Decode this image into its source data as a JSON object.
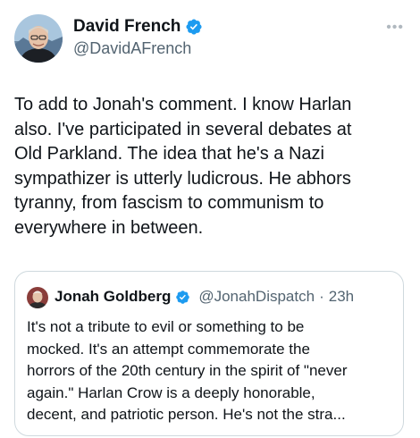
{
  "tweet": {
    "author_name": "David French",
    "author_handle": "@DavidAFrench",
    "more_label": "•••",
    "text_lines": [
      "To add to Jonah's comment. I know Harlan",
      "also. I've participated in several debates at",
      "Old Parkland. The idea that he's a Nazi",
      "sympathizer is utterly ludicrous. He abhors",
      "tyranny, from fascism to communism to",
      "everywhere in between."
    ]
  },
  "quote": {
    "author_name": "Jonah Goldberg",
    "author_handle": "@JonahDispatch",
    "separator": "·",
    "time": "23h",
    "text_lines": [
      "It's not a tribute to evil or something to be",
      "mocked. It's an attempt commemorate the",
      "horrors of the 20th century in the spirit of \"never",
      "again.\" Harlan Crow is a deeply honorable,",
      "decent, and patriotic person.  He's not the stra..."
    ]
  },
  "icons": {
    "verified": "verified-badge-icon",
    "more": "more-options-icon"
  },
  "colors": {
    "text": "#0f1419",
    "secondary": "#536471",
    "verified": "#1d9bf0",
    "border": "#cfd9de"
  }
}
